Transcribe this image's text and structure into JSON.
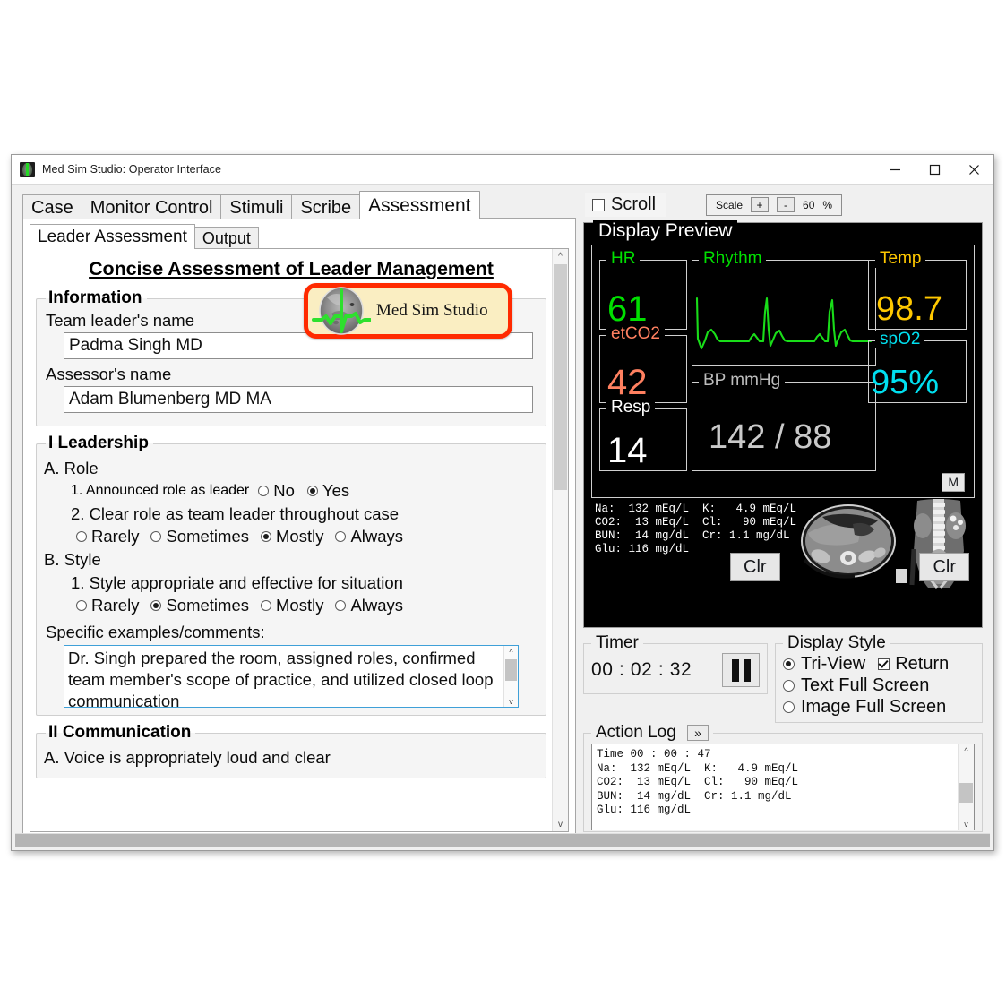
{
  "window": {
    "title": "Med Sim Studio: Operator Interface",
    "minimize": "–",
    "maximize": "□",
    "close": "×"
  },
  "tabs": [
    {
      "label": "Case",
      "active": false
    },
    {
      "label": "Monitor Control",
      "active": false
    },
    {
      "label": "Stimuli",
      "active": false
    },
    {
      "label": "Scribe",
      "active": false
    },
    {
      "label": "Assessment",
      "active": true
    }
  ],
  "subtabs": [
    {
      "label": "Leader Assessment",
      "active": true
    },
    {
      "label": "Output",
      "active": false
    }
  ],
  "toolbar": {
    "scroll_label": "Scroll",
    "scroll_checked": false,
    "scale_label": "Scale",
    "plus_label": "+",
    "minus_label": "-",
    "scale_value": "60",
    "percent_label": "%"
  },
  "form": {
    "title": "Concise Assessment of Leader Management",
    "logo_text": "Med Sim Studio",
    "information": {
      "legend": "Information",
      "team_leader_label": "Team leader's name",
      "team_leader_value": "Padma Singh MD",
      "assessor_label": "Assessor's name",
      "assessor_value": "Adam Blumenberg MD MA"
    },
    "leadership": {
      "legend": "I Leadership",
      "a_heading": "A. Role",
      "a1_text": "1. Announced role as leader",
      "a1_options": [
        "No",
        "Yes"
      ],
      "a1_selected": "Yes",
      "a2_text": "2. Clear role as team leader throughout case",
      "a2_options": [
        "Rarely",
        "Sometimes",
        "Mostly",
        "Always"
      ],
      "a2_selected": "Mostly",
      "b_heading": "B. Style",
      "b1_text": "1. Style appropriate and effective for situation",
      "b1_options": [
        "Rarely",
        "Sometimes",
        "Mostly",
        "Always"
      ],
      "b1_selected": "Sometimes",
      "comments_label": "Specific examples/comments:",
      "comments_value": "Dr. Singh prepared the room, assigned roles, confirmed team member's scope of practice, and utilized closed loop communication"
    },
    "communication": {
      "legend": "II Communication",
      "a_heading": "A. Voice is appropriately loud and clear"
    }
  },
  "monitor": {
    "legend": "Display Preview",
    "vitals": [
      {
        "name": "hr",
        "label": "HR",
        "value": "61",
        "color": "#00e000"
      },
      {
        "name": "etco2",
        "label": "etCO2",
        "value": "42",
        "color": "#ff8060"
      },
      {
        "name": "resp",
        "label": "Resp",
        "value": "14",
        "color": "#ffffff"
      },
      {
        "name": "rhythm",
        "label": "Rhythm",
        "value": "",
        "color": "#00e000"
      },
      {
        "name": "bp",
        "label": "BP  mmHg",
        "value": "142 / 88",
        "color": "#c9c9c9"
      },
      {
        "name": "temp",
        "label": "Temp",
        "value": "98.7",
        "color": "#ffc800"
      },
      {
        "name": "spo2",
        "label": "spO2",
        "value": "95%",
        "color": "#00e0f0"
      }
    ],
    "labs": "Na:  132 mEq/L  K:   4.9 mEq/L\nCO2:  13 mEq/L  Cl:   90 mEq/L\nBUN:  14 mg/dL  Cr: 1.1 mg/dL\nGlu: 116 mg/dL",
    "clr_left_label": "Clr",
    "clr_right_label": "Clr",
    "mode_button_label": "M"
  },
  "timer": {
    "legend": "Timer",
    "value": "00 : 02 : 32",
    "pause_label": "pause"
  },
  "display_style": {
    "legend": "Display Style",
    "options": [
      {
        "label": "Tri-View",
        "selected": true
      },
      {
        "label": "Text Full Screen",
        "selected": false
      },
      {
        "label": "Image Full Screen",
        "selected": false
      }
    ],
    "return_label": "Return",
    "return_checked": true
  },
  "action_log": {
    "legend": "Action Log",
    "expand_label": "»",
    "text": "Time 00 : 00 : 47\nNa:  132 mEq/L  K:   4.9 mEq/L\nCO2:  13 mEq/L  Cl:   90 mEq/L\nBUN:  14 mg/dL  Cr: 1.1 mg/dL\nGlu: 116 mg/dL"
  }
}
